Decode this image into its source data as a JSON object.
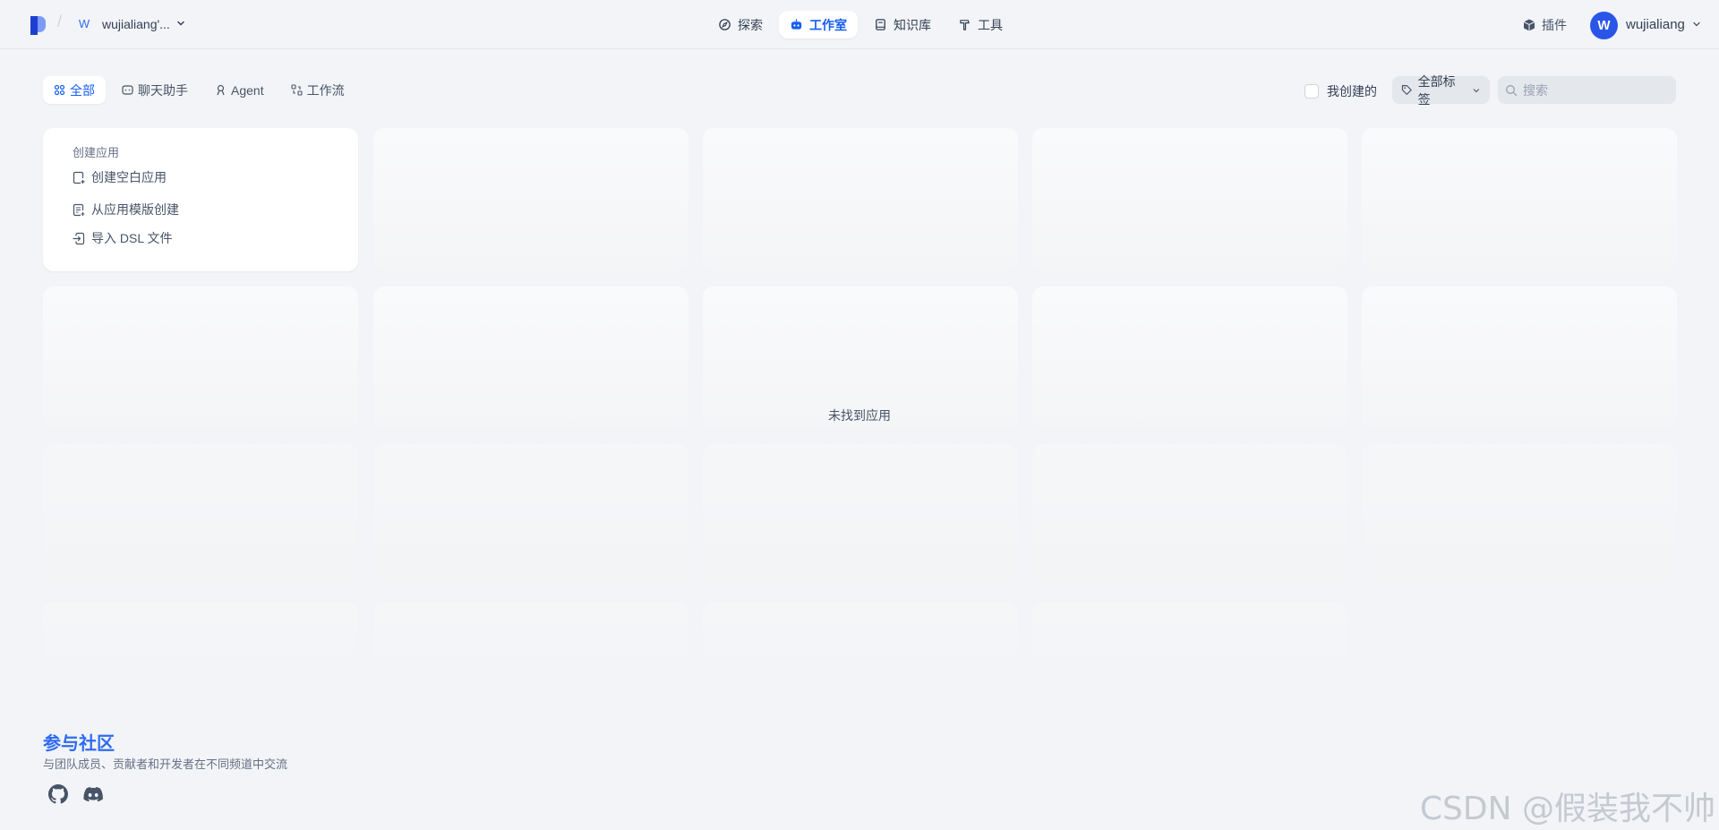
{
  "header": {
    "workspace_initial": "W",
    "workspace_name": "wujialiang'...",
    "nav": [
      {
        "label": "探索",
        "icon": "compass-icon",
        "active": false
      },
      {
        "label": "工作室",
        "icon": "robot-icon",
        "active": true
      },
      {
        "label": "知识库",
        "icon": "book-icon",
        "active": false
      },
      {
        "label": "工具",
        "icon": "hammer-icon",
        "active": false
      }
    ],
    "plugin_label": "插件",
    "user_initial": "W",
    "user_name": "wujialiang"
  },
  "filters": {
    "tabs": [
      {
        "label": "全部",
        "active": true
      },
      {
        "label": "聊天助手",
        "active": false
      },
      {
        "label": "Agent",
        "active": false
      },
      {
        "label": "工作流",
        "active": false
      }
    ],
    "mine_label": "我创建的",
    "mine_checked": false,
    "tag_label": "全部标签",
    "search_placeholder": "搜索",
    "search_value": ""
  },
  "create_card": {
    "title": "创建应用",
    "options": [
      "创建空白应用",
      "从应用模版创建",
      "导入 DSL 文件"
    ]
  },
  "empty_text": "未找到应用",
  "footer": {
    "title": "参与社区",
    "description": "与团队成员、贡献者和开发者在不同频道中交流",
    "socials": [
      "github-icon",
      "discord-icon"
    ]
  },
  "watermark": "CSDN @假装我不帅",
  "colors": {
    "accent": "#155eef",
    "avatar": "#2a56e8",
    "background": "#f2f4f7"
  }
}
